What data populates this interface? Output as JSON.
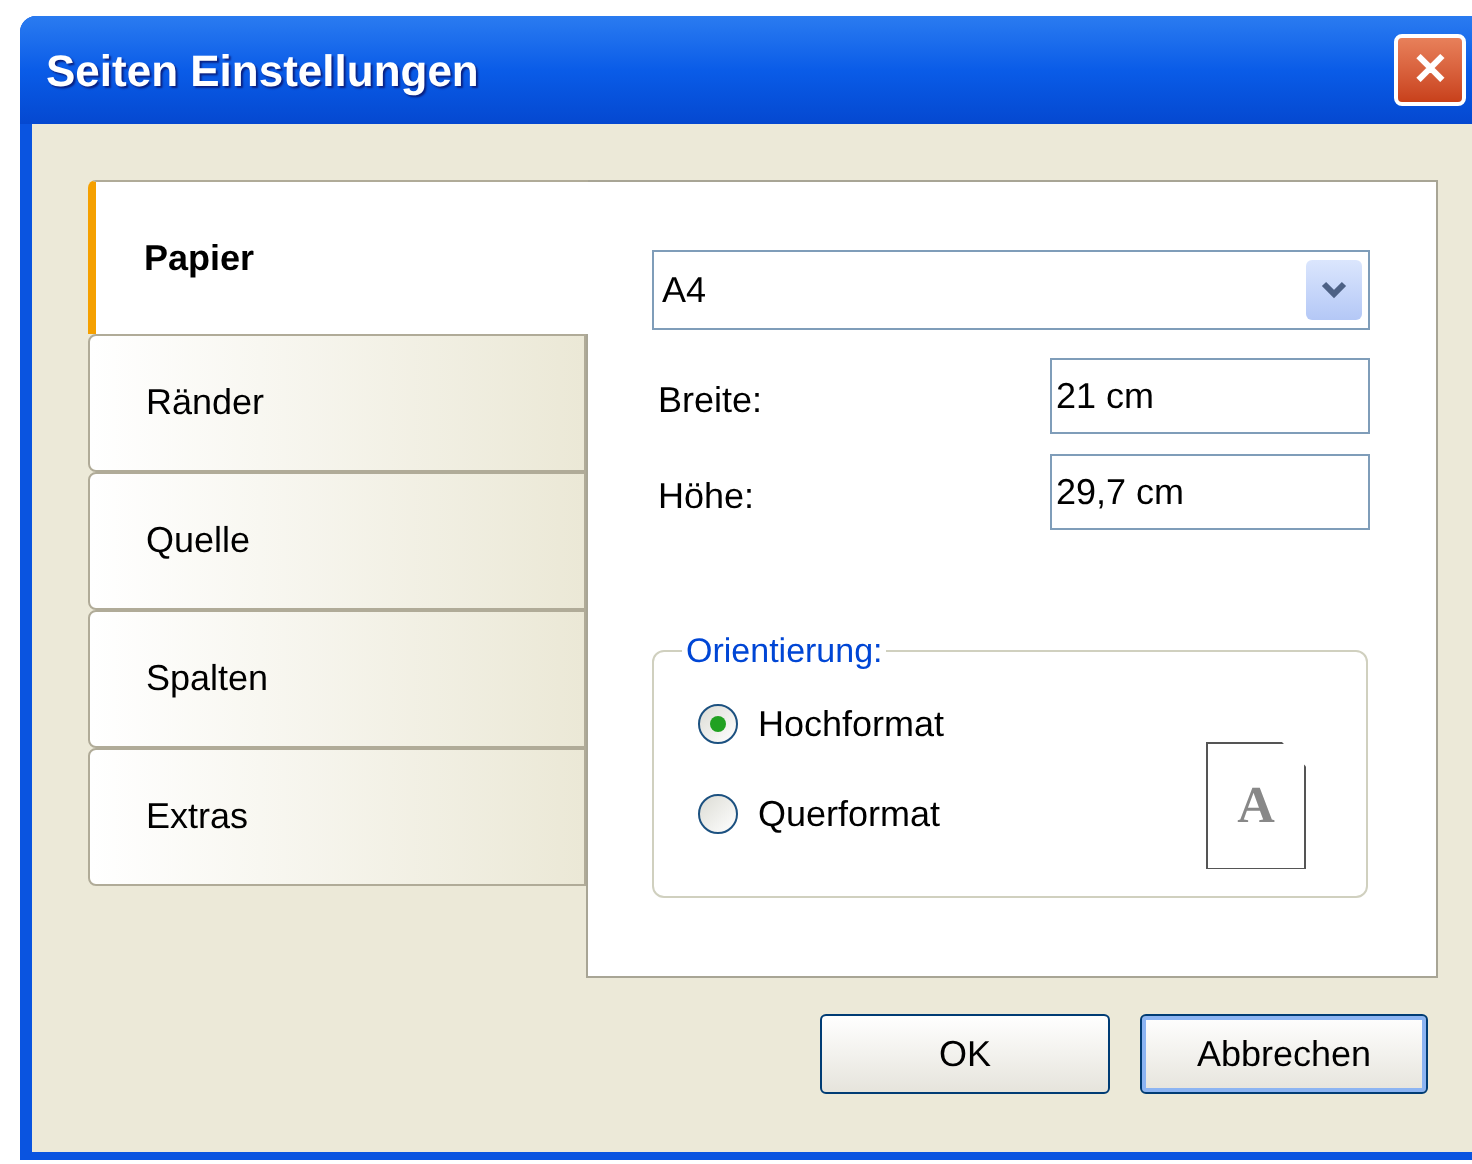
{
  "window": {
    "title": "Seiten Einstellungen",
    "close": "✕"
  },
  "tabs": [
    {
      "label": "Papier",
      "selected": true
    },
    {
      "label": "Ränder",
      "selected": false
    },
    {
      "label": "Quelle",
      "selected": false
    },
    {
      "label": "Spalten",
      "selected": false
    },
    {
      "label": "Extras",
      "selected": false
    }
  ],
  "paper_size": {
    "value": "A4"
  },
  "fields": [
    {
      "label": "Breite:",
      "value": "21 cm"
    },
    {
      "label": "Höhe:",
      "value": "29,7 cm"
    }
  ],
  "orientation": {
    "legend": "Orientierung:",
    "options": [
      {
        "label": "Hochformat",
        "selected": true
      },
      {
        "label": "Querformat",
        "selected": false
      }
    ],
    "page_icon_letter": "A"
  },
  "buttons": [
    {
      "label": "OK",
      "default": false
    },
    {
      "label": "Abbrechen",
      "default": true
    }
  ]
}
